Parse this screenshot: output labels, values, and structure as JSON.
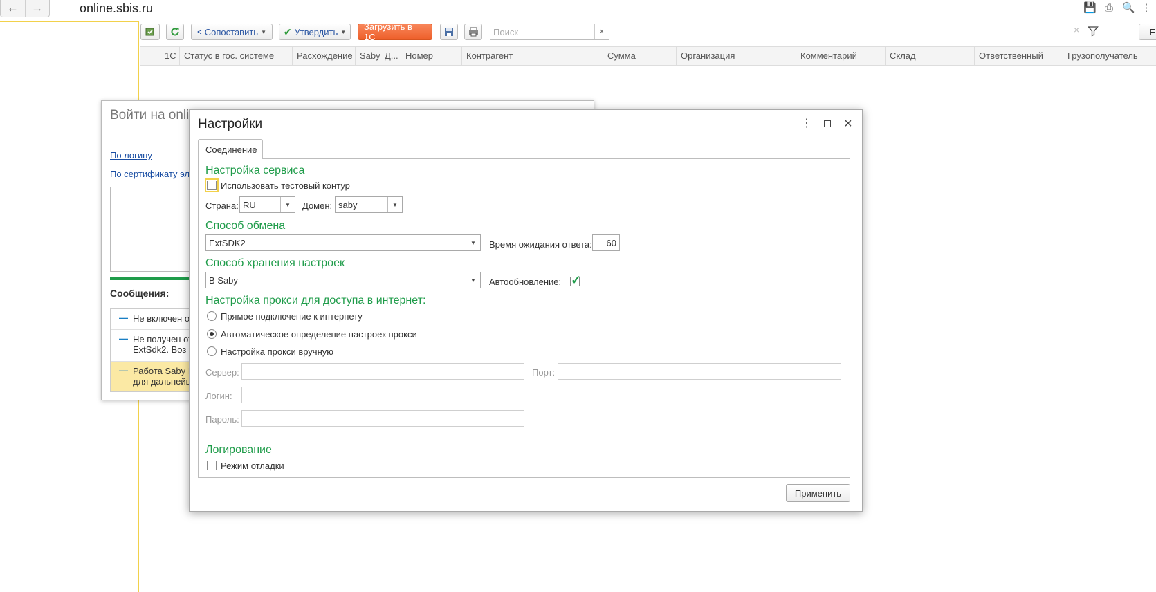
{
  "browser": {
    "site_title": "online.sbis.ru",
    "back_icon": "arrow-left-icon",
    "forward_icon": "arrow-right-icon"
  },
  "toolbar": {
    "compare_label": "Сопоставить",
    "approve_label": "Утвердить",
    "load_label": "Загрузить в 1С",
    "search_placeholder": "Поиск",
    "clear_glyph": "×",
    "right_button_label": "Е"
  },
  "table": {
    "columns": [
      "",
      "1С",
      "Статус в гос. системе",
      "Расхождение",
      "Saby",
      "Д...",
      "Номер",
      "Контрагент",
      "Сумма",
      "Организация",
      "Комментарий",
      "Склад",
      "Ответственный",
      "Грузополучатель"
    ]
  },
  "login_window": {
    "title": "Войти на onli",
    "by_login": "По логину",
    "by_certificate": "По сертификату эл",
    "messages_label": "Сообщения:",
    "messages": [
      {
        "line1": "Не включен о",
        "line2": ""
      },
      {
        "line1": "Не получен от",
        "line2": "ExtSdk2. Воз"
      },
      {
        "line1": "Работа Saby I",
        "line2": "для дальнейш"
      }
    ],
    "progress_color": "#1f9c4a",
    "highlight_color": "#fbe9a4"
  },
  "settings": {
    "title": "Настройки",
    "tab_connection": "Соединение",
    "service_section": "Настройка сервиса",
    "use_test_contour": "Использовать тестовый контур",
    "country_label": "Страна:",
    "country_value": "RU",
    "domain_label": "Домен:",
    "domain_value": "saby",
    "exchange_section": "Способ обмена",
    "exchange_value": "ExtSDK2",
    "timeout_label": "Время ожидания ответа:",
    "timeout_value": "60",
    "storage_section": "Способ хранения настроек",
    "storage_value": "В Saby",
    "autoupdate_label": "Автообновление:",
    "proxy_section": "Настройка прокси для доступа в интернет:",
    "proxy_options": [
      "Прямое подключение к интернету",
      "Автоматическое определение настроек прокси",
      "Настройка прокси вручную"
    ],
    "server_label": "Сервер:",
    "port_label": "Порт:",
    "login_label": "Логин:",
    "password_label": "Пароль:",
    "logging_section": "Логирование",
    "debug_mode": "Режим отладки",
    "apply_label": "Применить",
    "accent_color": "#1f9c4a"
  }
}
